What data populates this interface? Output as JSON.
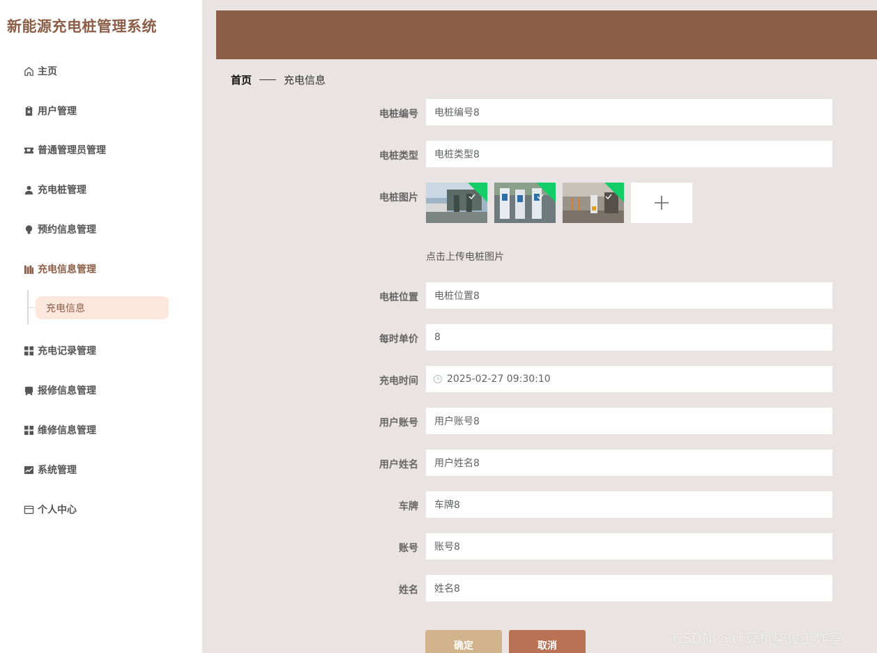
{
  "app": {
    "title": "新能源充电桩管理系统"
  },
  "sidebar": {
    "items": [
      {
        "label": "主页",
        "icon": "home-icon"
      },
      {
        "label": "用户管理",
        "icon": "clipboard-icon"
      },
      {
        "label": "普通管理员管理",
        "icon": "ticket-icon"
      },
      {
        "label": "充电桩管理",
        "icon": "user-icon"
      },
      {
        "label": "预约信息管理",
        "icon": "bulb-icon"
      },
      {
        "label": "充电信息管理",
        "icon": "books-icon",
        "active": true
      },
      {
        "label": "充电记录管理",
        "icon": "grid-icon"
      },
      {
        "label": "报修信息管理",
        "icon": "bus-icon"
      },
      {
        "label": "维修信息管理",
        "icon": "grid-icon"
      },
      {
        "label": "系统管理",
        "icon": "chart-icon"
      },
      {
        "label": "个人中心",
        "icon": "card-icon"
      }
    ],
    "submenu": {
      "label": "充电信息"
    }
  },
  "breadcrumb": {
    "home": "首页",
    "current": "充电信息"
  },
  "form": {
    "fields": [
      {
        "label": "电桩编号",
        "value": "电桩编号8"
      },
      {
        "label": "电桩类型",
        "value": "电桩类型8"
      },
      {
        "label": "电桩图片"
      },
      {
        "label": "电桩位置",
        "value": "电桩位置8"
      },
      {
        "label": "每时单价",
        "value": "8"
      },
      {
        "label": "充电时间",
        "value": "2025-02-27 09:30:10"
      },
      {
        "label": "用户账号",
        "value": "用户账号8"
      },
      {
        "label": "用户姓名",
        "value": "用户姓名8"
      },
      {
        "label": "车牌",
        "value": "车牌8"
      },
      {
        "label": "账号",
        "value": "账号8"
      },
      {
        "label": "姓名",
        "value": "姓名8"
      }
    ],
    "upload_hint": "点击上传电桩图片",
    "upload_success_color": "#13ce66"
  },
  "buttons": {
    "confirm": "确定",
    "cancel": "取消"
  },
  "watermark": "CSDN @计算机毕设工作室",
  "colors": {
    "brand": "#8c5e47",
    "confirm": "#d2b48c",
    "cancel": "#b87254",
    "background": "#e9e3e3"
  }
}
